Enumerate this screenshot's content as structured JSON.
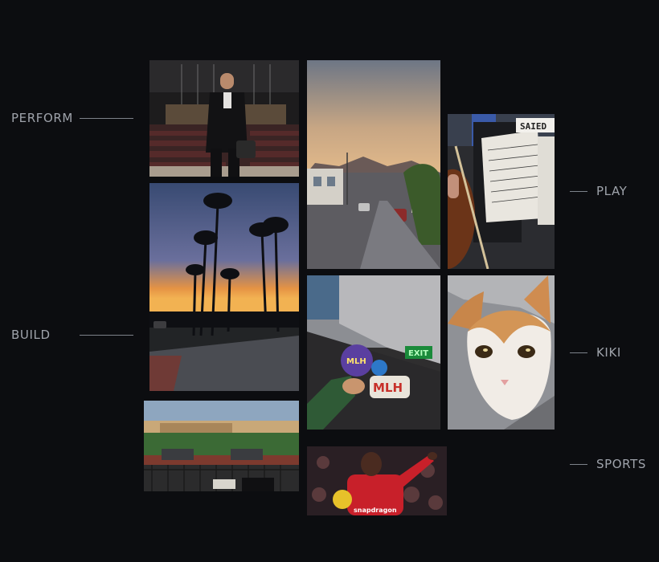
{
  "labels": {
    "perform": "PERFORM",
    "build": "BUILD",
    "play": "PLAY",
    "kiki": "KIKI",
    "sports": "SPORTS"
  },
  "photos": {
    "music_stand_sign": "SAIED",
    "sticker_top": "MLH",
    "sticker_bottom": "MLH",
    "exit_sign": "EXIT",
    "jersey_sponsor": "snapdragon"
  },
  "colors": {
    "background": "#0c0d10",
    "label_text": "#9fa3ab",
    "label_line": "#7d828a"
  }
}
